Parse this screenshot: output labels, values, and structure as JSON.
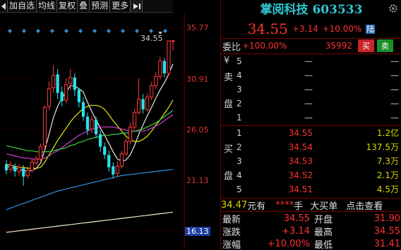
{
  "toolbar": {
    "items": [
      "加自选",
      "均线",
      "复权",
      "叠",
      "预测",
      "更多"
    ]
  },
  "chart": {
    "price_labels": [
      "35.77",
      "30.91",
      "26.05",
      "21.13",
      "16.13"
    ],
    "peak_label": "34.55"
  },
  "chart_data": {
    "type": "candlestick",
    "ylim": [
      16.13,
      35.77
    ],
    "y_ticks": [
      35.77,
      30.91,
      26.05,
      21.13,
      16.13
    ],
    "peak": 34.55,
    "candles": [
      {
        "o": 22.6,
        "c": 22.0,
        "h": 23.0,
        "l": 21.6
      },
      {
        "o": 22.1,
        "c": 22.5,
        "h": 22.9,
        "l": 21.8
      },
      {
        "o": 22.4,
        "c": 21.9,
        "h": 22.7,
        "l": 21.4
      },
      {
        "o": 21.9,
        "c": 22.3,
        "h": 22.6,
        "l": 21.5
      },
      {
        "o": 22.2,
        "c": 21.4,
        "h": 22.5,
        "l": 20.5
      },
      {
        "o": 21.5,
        "c": 22.0,
        "h": 22.4,
        "l": 21.2
      },
      {
        "o": 22.0,
        "c": 22.8,
        "h": 23.1,
        "l": 21.8
      },
      {
        "o": 22.7,
        "c": 23.1,
        "h": 23.4,
        "l": 22.5
      },
      {
        "o": 23.1,
        "c": 24.3,
        "h": 24.6,
        "l": 22.9
      },
      {
        "o": 24.4,
        "c": 28.1,
        "h": 28.3,
        "l": 24.1
      },
      {
        "o": 28.2,
        "c": 29.9,
        "h": 30.6,
        "l": 27.8
      },
      {
        "o": 30.0,
        "c": 31.2,
        "h": 32.2,
        "l": 29.5
      },
      {
        "o": 31.3,
        "c": 29.5,
        "h": 31.8,
        "l": 28.9
      },
      {
        "o": 29.6,
        "c": 28.7,
        "h": 30.1,
        "l": 28.2
      },
      {
        "o": 28.8,
        "c": 30.3,
        "h": 30.9,
        "l": 28.5
      },
      {
        "o": 30.4,
        "c": 31.0,
        "h": 31.8,
        "l": 29.8
      },
      {
        "o": 31.0,
        "c": 29.8,
        "h": 31.4,
        "l": 29.2
      },
      {
        "o": 29.8,
        "c": 28.6,
        "h": 30.0,
        "l": 28.1
      },
      {
        "o": 28.6,
        "c": 27.2,
        "h": 29.1,
        "l": 26.8
      },
      {
        "o": 27.2,
        "c": 25.9,
        "h": 27.6,
        "l": 25.4
      },
      {
        "o": 26.0,
        "c": 26.9,
        "h": 27.3,
        "l": 25.6
      },
      {
        "o": 26.9,
        "c": 25.5,
        "h": 27.2,
        "l": 25.1
      },
      {
        "o": 25.5,
        "c": 24.3,
        "h": 25.9,
        "l": 23.8
      },
      {
        "o": 24.3,
        "c": 23.5,
        "h": 24.7,
        "l": 23.1
      },
      {
        "o": 23.5,
        "c": 22.3,
        "h": 23.9,
        "l": 21.9
      },
      {
        "o": 22.4,
        "c": 21.6,
        "h": 22.8,
        "l": 21.2
      },
      {
        "o": 21.7,
        "c": 22.4,
        "h": 22.9,
        "l": 21.4
      },
      {
        "o": 22.4,
        "c": 23.6,
        "h": 23.9,
        "l": 22.2
      },
      {
        "o": 23.6,
        "c": 24.8,
        "h": 25.1,
        "l": 23.4
      },
      {
        "o": 24.8,
        "c": 26.2,
        "h": 26.6,
        "l": 24.5
      },
      {
        "o": 26.2,
        "c": 27.6,
        "h": 27.9,
        "l": 25.9
      },
      {
        "o": 27.6,
        "c": 28.9,
        "h": 30.9,
        "l": 27.4
      },
      {
        "o": 28.9,
        "c": 27.9,
        "h": 29.4,
        "l": 27.5
      },
      {
        "o": 27.9,
        "c": 29.1,
        "h": 29.5,
        "l": 27.7
      },
      {
        "o": 29.1,
        "c": 30.2,
        "h": 30.6,
        "l": 28.8
      },
      {
        "o": 30.2,
        "c": 31.1,
        "h": 31.5,
        "l": 29.9
      },
      {
        "o": 31.1,
        "c": 32.6,
        "h": 33.0,
        "l": 30.8
      },
      {
        "o": 32.6,
        "c": 31.4,
        "h": 32.9,
        "l": 31.0
      },
      {
        "o": 31.4,
        "c": 34.55,
        "h": 34.55,
        "l": 31.2
      },
      {
        "o": 34.55,
        "c": 34.55,
        "h": 34.55,
        "l": 33.6
      }
    ],
    "ma": [
      {
        "name": "MA5",
        "color": "#e8e8e8",
        "values": [
          22.4,
          22.3,
          22.2,
          22.1,
          22.0,
          21.9,
          22.0,
          22.2,
          22.7,
          24.0,
          25.5,
          27.1,
          28.2,
          29.0,
          29.6,
          30.2,
          30.2,
          29.9,
          29.6,
          28.6,
          27.7,
          26.9,
          26.1,
          25.4,
          24.6,
          23.8,
          23.1,
          22.9,
          23.0,
          23.5,
          24.4,
          25.5,
          26.4,
          27.3,
          28.1,
          29.0,
          29.8,
          30.5,
          31.3,
          32.3
        ]
      },
      {
        "name": "MA10",
        "color": "#e8e800",
        "values": [
          22.6,
          22.5,
          22.4,
          22.3,
          22.3,
          22.2,
          22.2,
          22.2,
          22.3,
          22.8,
          23.5,
          24.2,
          24.9,
          25.5,
          26.1,
          26.7,
          27.2,
          27.6,
          28.0,
          28.2,
          28.3,
          28.3,
          28.2,
          27.9,
          27.4,
          26.8,
          26.3,
          25.8,
          25.3,
          25.0,
          24.8,
          24.8,
          25.0,
          25.3,
          25.8,
          26.4,
          26.9,
          27.5,
          28.1,
          28.8
        ]
      },
      {
        "name": "MA20",
        "color": "#d040d0",
        "values": [
          23.6,
          23.5,
          23.4,
          23.3,
          23.2,
          23.2,
          23.1,
          23.1,
          23.1,
          23.2,
          23.4,
          23.7,
          23.9,
          24.2,
          24.5,
          24.8,
          25.1,
          25.4,
          25.6,
          25.8,
          26.0,
          26.1,
          26.2,
          26.2,
          26.2,
          26.2,
          26.1,
          26.0,
          25.9,
          25.8,
          25.8,
          25.8,
          25.8,
          25.9,
          26.1,
          26.3,
          26.5,
          26.8,
          27.1,
          27.4
        ]
      },
      {
        "name": "MA30",
        "color": "#40d040",
        "values": [
          24.4,
          24.3,
          24.2,
          24.1,
          24.0,
          23.9,
          23.9,
          23.8,
          23.8,
          23.8,
          23.8,
          23.9,
          24.0,
          24.1,
          24.2,
          24.4,
          24.5,
          24.7,
          24.8,
          25.0,
          25.1,
          25.2,
          25.3,
          25.4,
          25.4,
          25.5,
          25.5,
          25.6,
          25.6,
          25.7,
          25.8,
          25.9,
          26.0,
          26.2,
          26.4,
          26.6,
          26.9,
          27.2,
          27.5,
          27.8
        ]
      },
      {
        "name": "MA60",
        "color": "#3090e0",
        "values": [
          18.2,
          18.35,
          18.5,
          18.65,
          18.8,
          18.95,
          19.1,
          19.25,
          19.4,
          19.55,
          19.7,
          19.85,
          20.0,
          20.1,
          20.2,
          20.3,
          20.4,
          20.5,
          20.6,
          20.7,
          20.8,
          20.9,
          21.0,
          21.1,
          21.2,
          21.3,
          21.4,
          21.5,
          21.55,
          21.6,
          21.65,
          21.7,
          21.75,
          21.8,
          21.85,
          21.9,
          21.95,
          22.0,
          22.05,
          22.1
        ]
      },
      {
        "name": "MA120",
        "color": "#f0f0d0",
        "values": [
          16.0,
          16.05,
          16.1,
          16.15,
          16.2,
          16.25,
          16.3,
          16.35,
          16.4,
          16.45,
          16.5,
          16.55,
          16.6,
          16.65,
          16.7,
          16.75,
          16.8,
          16.85,
          16.9,
          16.95,
          17.0,
          17.05,
          17.1,
          17.15,
          17.2,
          17.25,
          17.3,
          17.35,
          17.4,
          17.45,
          17.5,
          17.55,
          17.6,
          17.65,
          17.7,
          17.75,
          17.8,
          17.85,
          17.9,
          17.95
        ]
      }
    ]
  },
  "panel": {
    "title": "掌阅科技 603533",
    "price": "34.55",
    "change": "+3.14",
    "change_pct": "+10.00%",
    "badge": "陆",
    "webi_label": "委比",
    "webi_pct": "+100.00%",
    "webi_num": "35992",
    "buy_btn": "买",
    "sell_btn": "卖",
    "sell_side": {
      "label_chars": [
        "¥",
        "卖",
        "盘"
      ],
      "levels": [
        "5",
        "4",
        "3",
        "2",
        "1"
      ],
      "placeholder": "—"
    },
    "buy_side": {
      "label_chars": [
        "买",
        "盘"
      ],
      "rows": [
        {
          "lvl": "1",
          "price": "34.55",
          "vol": "1.2亿"
        },
        {
          "lvl": "2",
          "price": "34.54",
          "vol": "137.5万"
        },
        {
          "lvl": "3",
          "price": "34.53",
          "vol": "7.3万"
        },
        {
          "lvl": "4",
          "price": "34.52",
          "vol": "2.1万"
        },
        {
          "lvl": "5",
          "price": "34.51",
          "vol": "4.5万"
        }
      ]
    },
    "notice": {
      "price": "34.47",
      "unit": "元有",
      "amount": "****",
      "hand": "手",
      "big": "大买单",
      "link": "点击查看"
    },
    "stats": [
      {
        "l": "最新",
        "v": "34.55",
        "l2": "开盘",
        "v2": "31.90"
      },
      {
        "l": "涨跌",
        "v": "+3.14",
        "l2": "最高",
        "v2": "34.55"
      },
      {
        "l": "涨幅",
        "v": "+10.00%",
        "l2": "最低",
        "v2": "31.41"
      }
    ]
  }
}
